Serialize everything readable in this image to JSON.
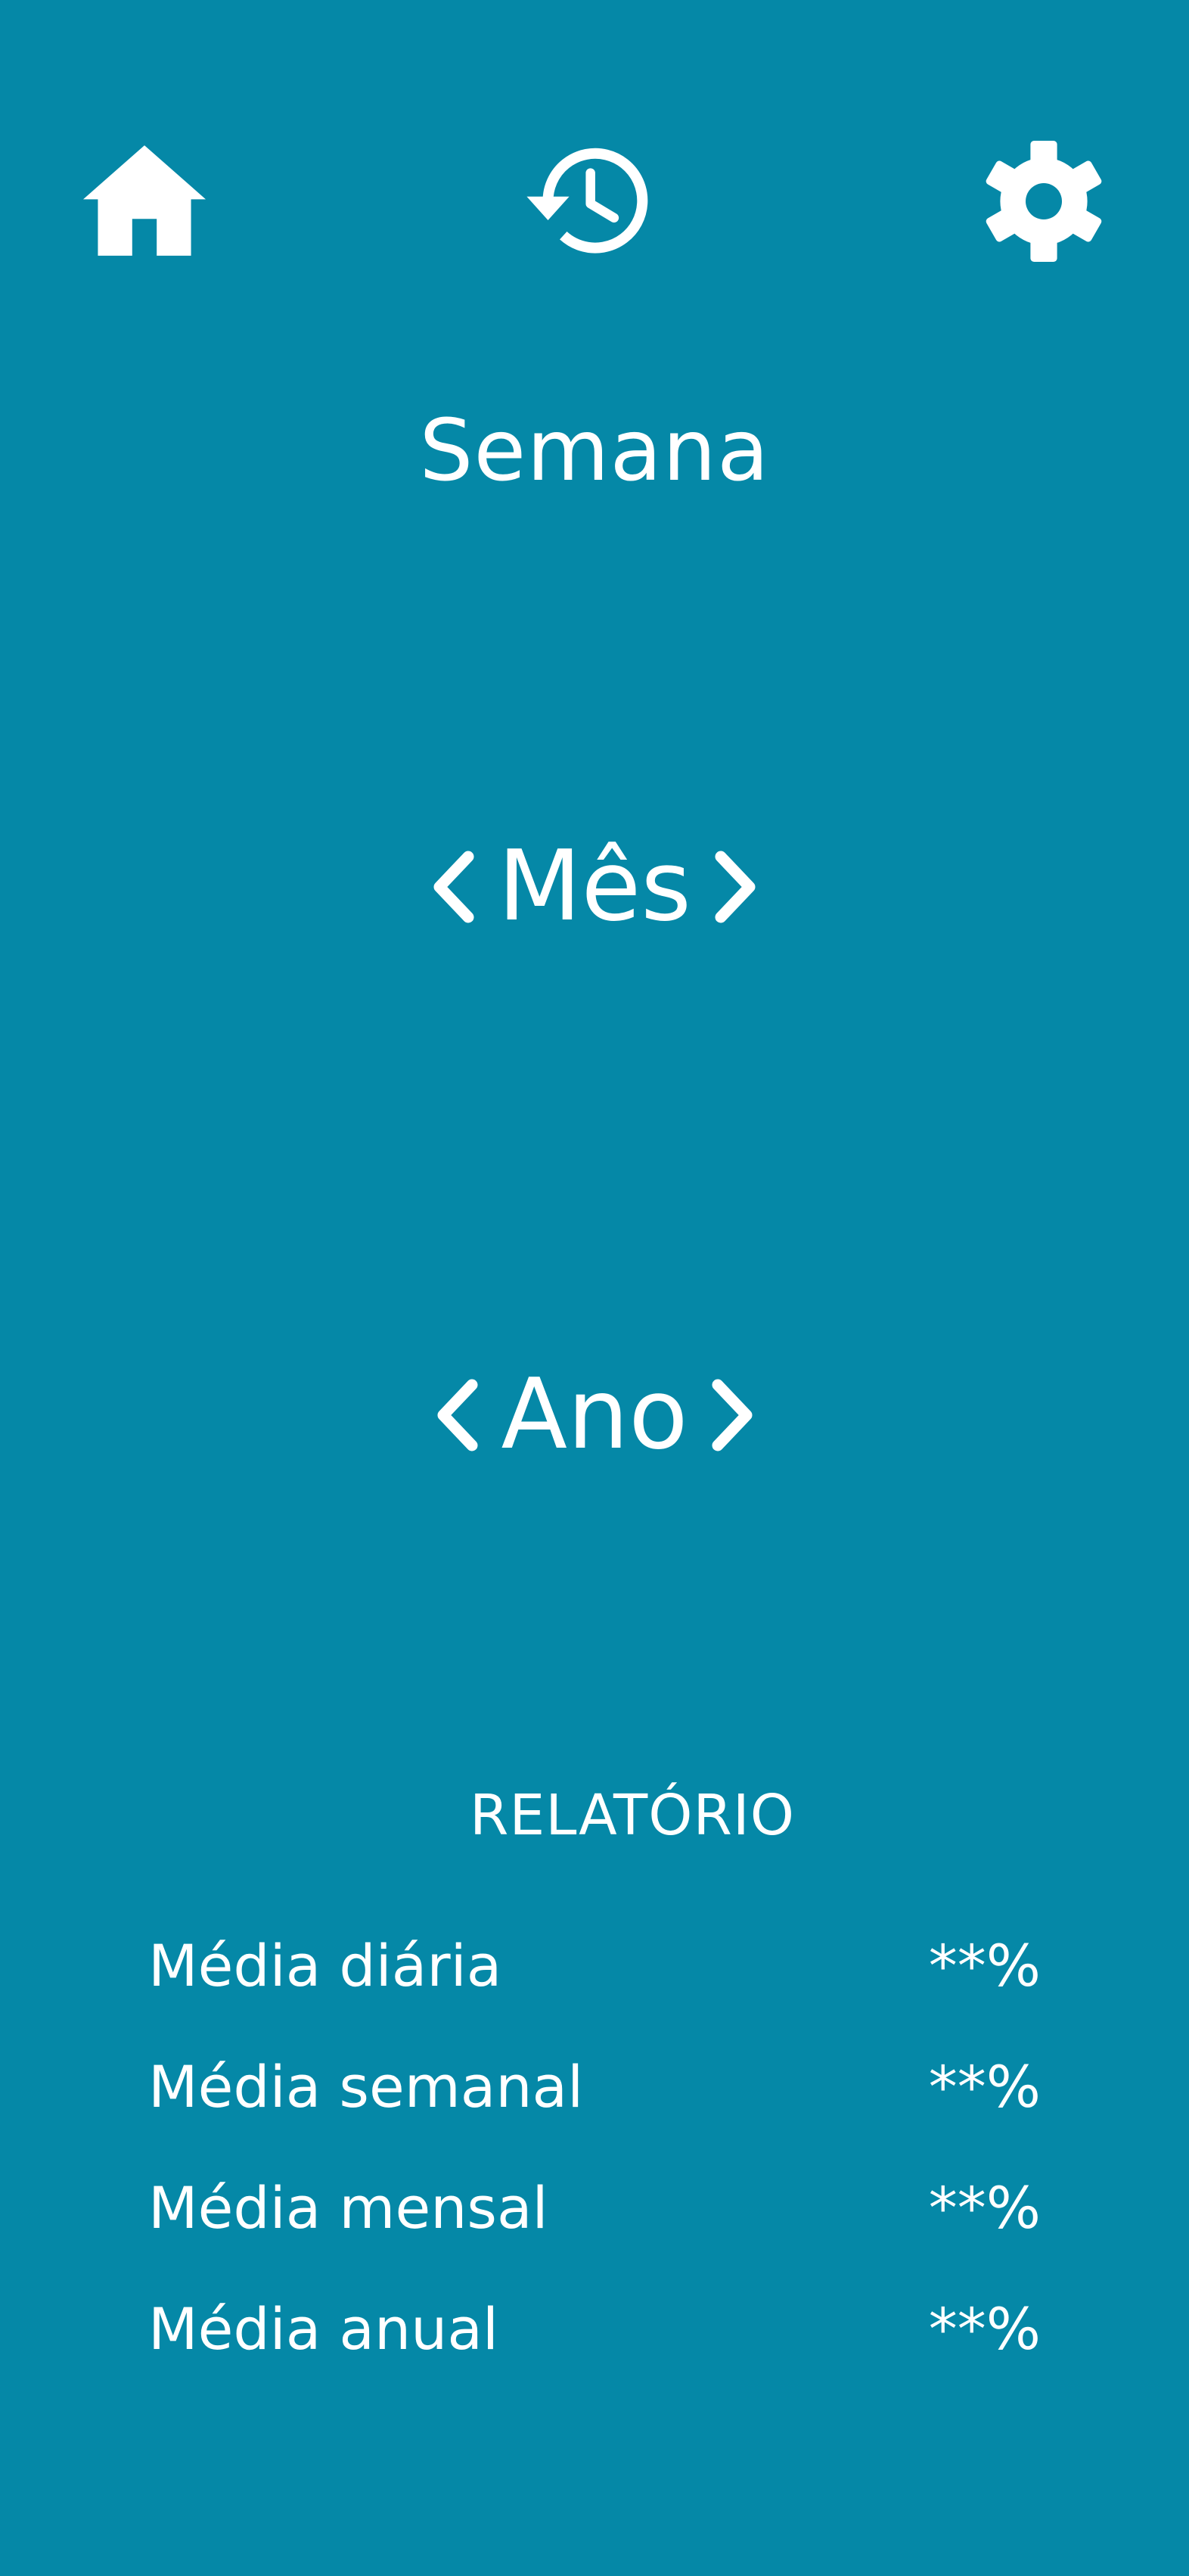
{
  "theme": {
    "background": "#0588a7",
    "foreground": "#ffffff"
  },
  "nav": {
    "home_icon": "home-icon",
    "history_icon": "history-icon",
    "settings_icon": "gear-icon"
  },
  "periods": {
    "week": "Semana",
    "month": "Mês",
    "year": "Ano"
  },
  "report": {
    "heading": "RELATÓRIO",
    "rows": [
      {
        "label": "Média diária",
        "value": "**%"
      },
      {
        "label": "Média semanal",
        "value": "**%"
      },
      {
        "label": "Média mensal",
        "value": "**%"
      },
      {
        "label": "Média anual",
        "value": "**%"
      }
    ]
  }
}
